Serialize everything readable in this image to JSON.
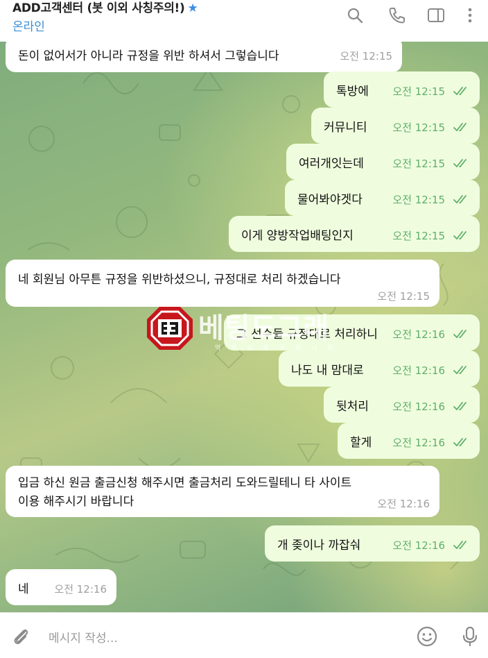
{
  "header": {
    "title": "ADD고객센터 (봇 이외 사칭주의!)",
    "star_glyph": "★",
    "status": "온라인",
    "icons": [
      "search-icon",
      "phone-icon",
      "sidebar-toggle-icon",
      "more-vertical-icon"
    ]
  },
  "messages": [
    {
      "dir": "in",
      "text": "돈이 없어서가 아니라 규정을 위반 하셔서 그렇습니다",
      "time": "오전 12:15"
    },
    {
      "dir": "out",
      "text": "톡방에",
      "time": "오전 12:15",
      "status_icon": "double-check-icon"
    },
    {
      "dir": "out",
      "text": "커뮤니티",
      "time": "오전 12:15",
      "status_icon": "double-check-icon"
    },
    {
      "dir": "out",
      "text": "여러개잇는데",
      "time": "오전 12:15",
      "status_icon": "double-check-icon"
    },
    {
      "dir": "out",
      "text": "물어봐야겟다",
      "time": "오전 12:15",
      "status_icon": "double-check-icon"
    },
    {
      "dir": "out",
      "text": "이게 양방작업배팅인지",
      "time": "오전 12:15",
      "status_icon": "double-check-icon"
    },
    {
      "dir": "in",
      "text": "네 회원님 아무튼 규정을 위반하셨으니, 규정대로 처리 하겠습니다",
      "time": "오전 12:15"
    },
    {
      "dir": "out",
      "text": "그 선수들 규정대로 처리하니",
      "time": "오전 12:16",
      "status_icon": "double-check-icon"
    },
    {
      "dir": "out",
      "text": "나도 내 맘대로",
      "time": "오전 12:16",
      "status_icon": "double-check-icon"
    },
    {
      "dir": "out",
      "text": "뒷처리",
      "time": "오전 12:16",
      "status_icon": "double-check-icon"
    },
    {
      "dir": "out",
      "text": "할게",
      "time": "오전 12:16",
      "status_icon": "double-check-icon"
    },
    {
      "dir": "in",
      "text": "입금 하신 원금 출금신청 해주시면 출금처리 도와드릴테니 타 사이트\n이용 해주시기 바랍니다",
      "time": "오전 12:16"
    },
    {
      "dir": "out",
      "text": "개 좆이나 까잡숴",
      "time": "오전 12:16",
      "status_icon": "double-check-icon"
    },
    {
      "dir": "in",
      "text": "네",
      "time": "오전 12:16"
    }
  ],
  "watermark": {
    "text": "베팅도그래",
    "sub": "먹 튀 검 증 커 뮤 니 티"
  },
  "composer": {
    "placeholder": "메시지 작성...",
    "icons": [
      "attach-icon",
      "emoji-icon",
      "microphone-icon"
    ]
  },
  "colors": {
    "outgoing_bubble": "#effdde",
    "incoming_bubble": "#ffffff",
    "status_online": "#3a8fd6",
    "time_outgoing": "#5fae6a",
    "check": "#5fae6a",
    "accent": "#3b8ee0"
  }
}
